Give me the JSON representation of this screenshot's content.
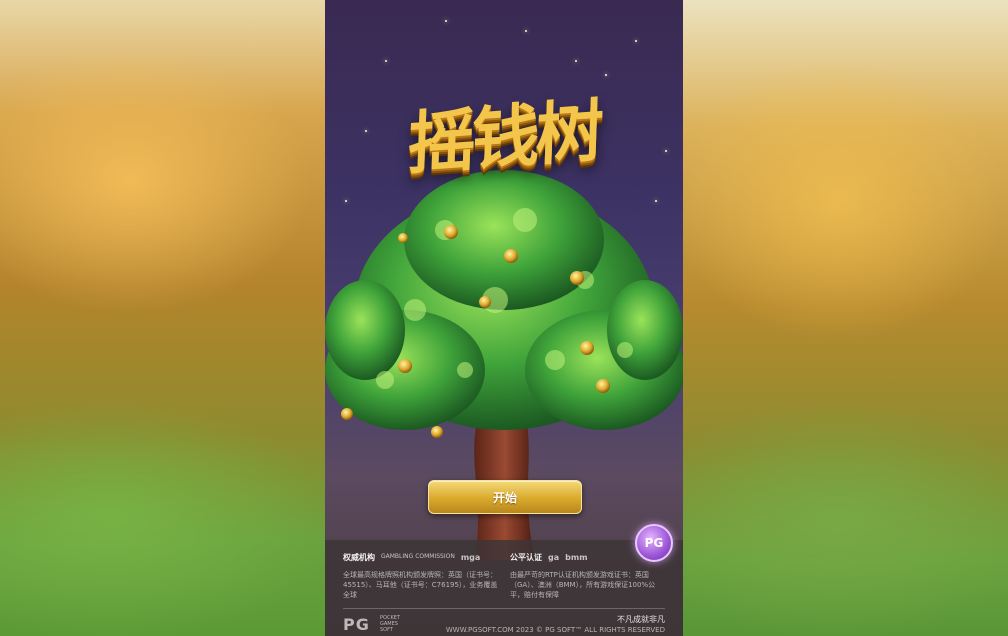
{
  "game": {
    "title": "摇钱树",
    "start_label": "开始",
    "badge_label": "PG"
  },
  "info": {
    "authority": {
      "title": "权威机构",
      "logos": [
        "GAMBLING COMMISSION",
        "mga"
      ],
      "body": "全球最高规格牌照机构颁发牌照：英国（证书号：45515）、马耳他（证书号：C76195），业务覆盖全球"
    },
    "certification": {
      "title": "公平认证",
      "logos": [
        "ga",
        "bmm"
      ],
      "body": "由最严苛的RTP认证机构颁发游戏证书：英国（GA）、澳洲（BMM），所有游戏保证100%公平，赔付有保障"
    }
  },
  "footer": {
    "logo": "PG",
    "logo_sub": "POCKET GAMES SOFT",
    "slogan": "不凡成就非凡",
    "copyright": "WWW.PGSOFT.COM   2023 © PG SOFT™ ALL RIGHTS RESERVED"
  },
  "colors": {
    "gold": "#f3c54a",
    "button_top": "#f4d97a",
    "button_bottom": "#b9861c",
    "panel": "#3c3437",
    "badge": "#9b55d6"
  }
}
